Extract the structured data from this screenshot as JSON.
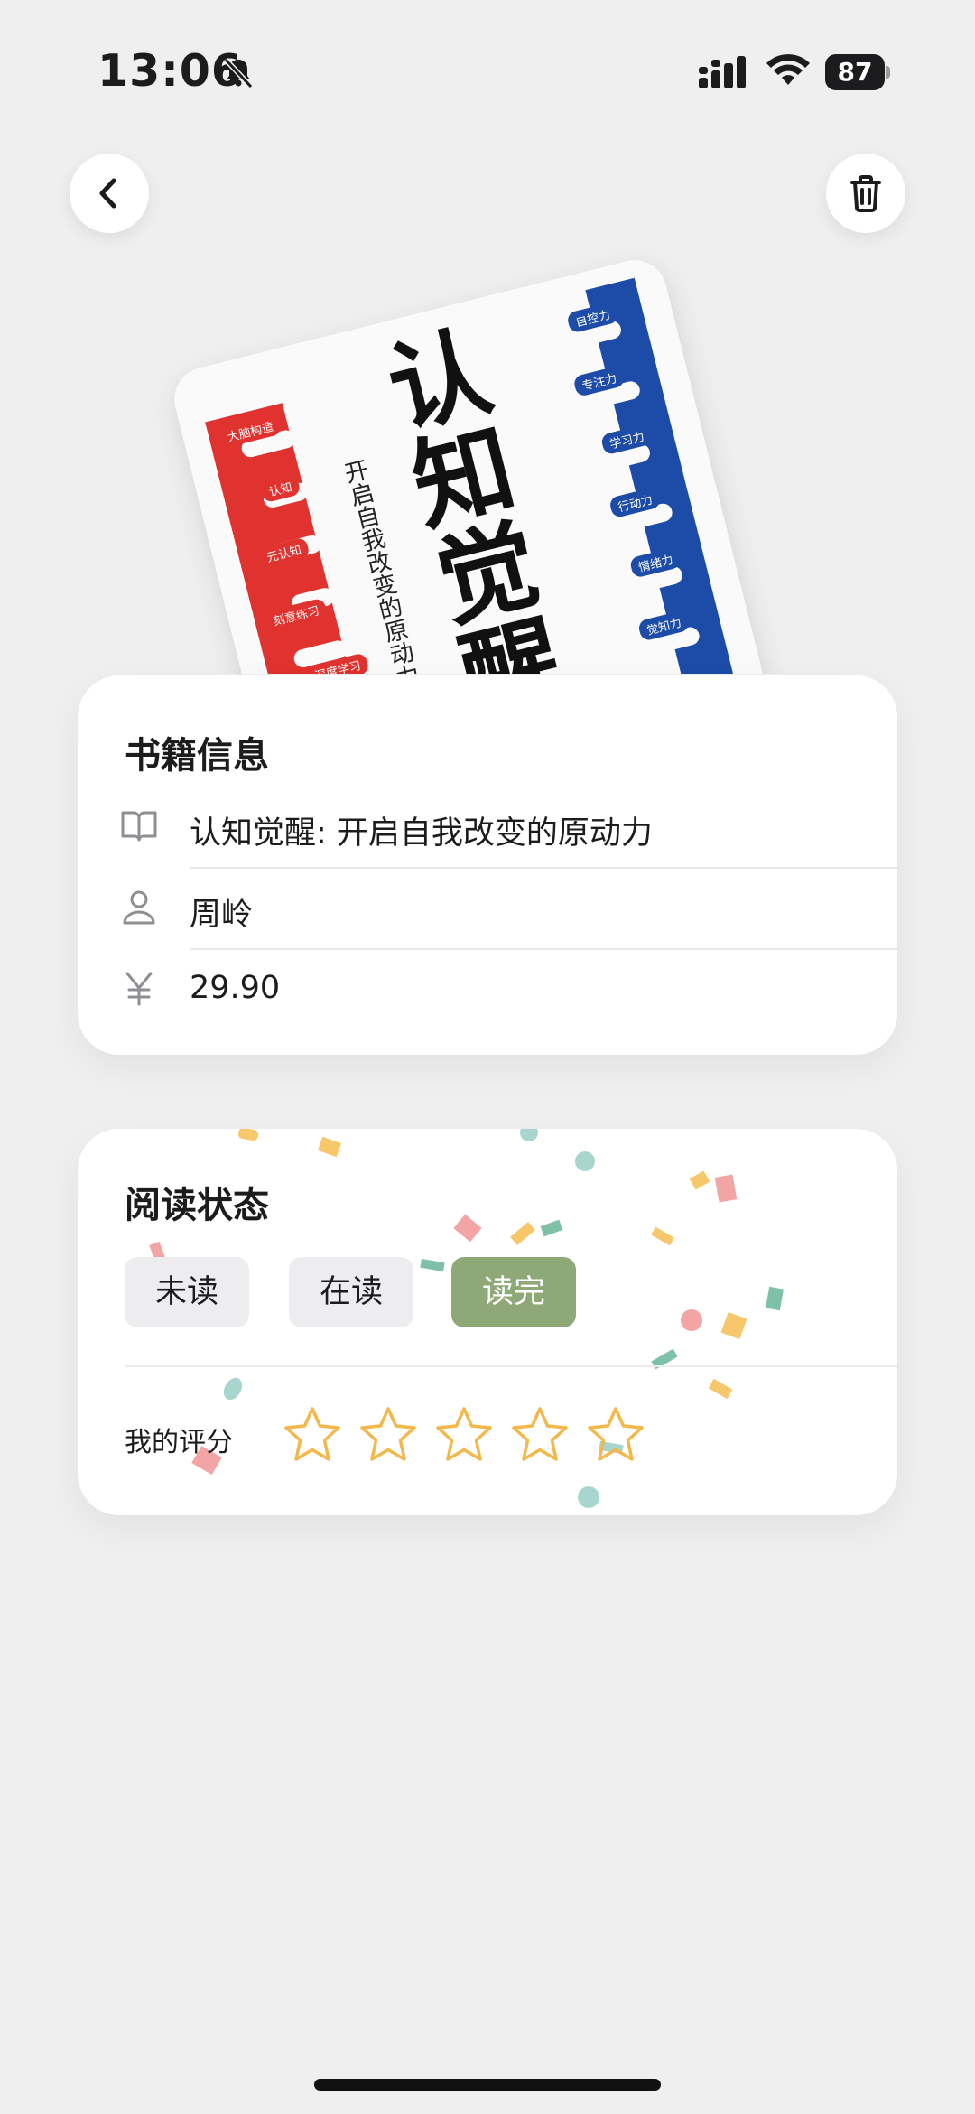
{
  "status_bar": {
    "time": "13:06",
    "battery": "87",
    "icons": [
      "bell-slash-icon",
      "signal-icon",
      "wifi-icon",
      "battery-icon"
    ]
  },
  "nav": {
    "back_icon": "chevron-left-icon",
    "delete_icon": "trash-icon"
  },
  "cover": {
    "title": "认知觉醒",
    "subtitle": "开启自我改变的原动力",
    "left_tags": [
      "大脑构造",
      "认知",
      "元认知",
      "刻意练习",
      "深度学习"
    ],
    "right_tags": [
      "自控力",
      "专注力",
      "学习力",
      "行动力",
      "情绪力",
      "觉知力"
    ]
  },
  "book_info": {
    "heading": "书籍信息",
    "title_icon": "book-icon",
    "title": "认知觉醒: 开启自我改变的原动力",
    "author_icon": "person-icon",
    "author": "周岭",
    "price_icon": "yen-icon",
    "price": "29.90"
  },
  "reading_status": {
    "heading": "阅读状态",
    "options": [
      "未读",
      "在读",
      "读完"
    ],
    "selected": "读完",
    "rating_label": "我的评分",
    "rating": 0,
    "max_rating": 5,
    "colors": {
      "selected_chip": "#8FA878",
      "star_outline": "#F2B84B"
    }
  }
}
